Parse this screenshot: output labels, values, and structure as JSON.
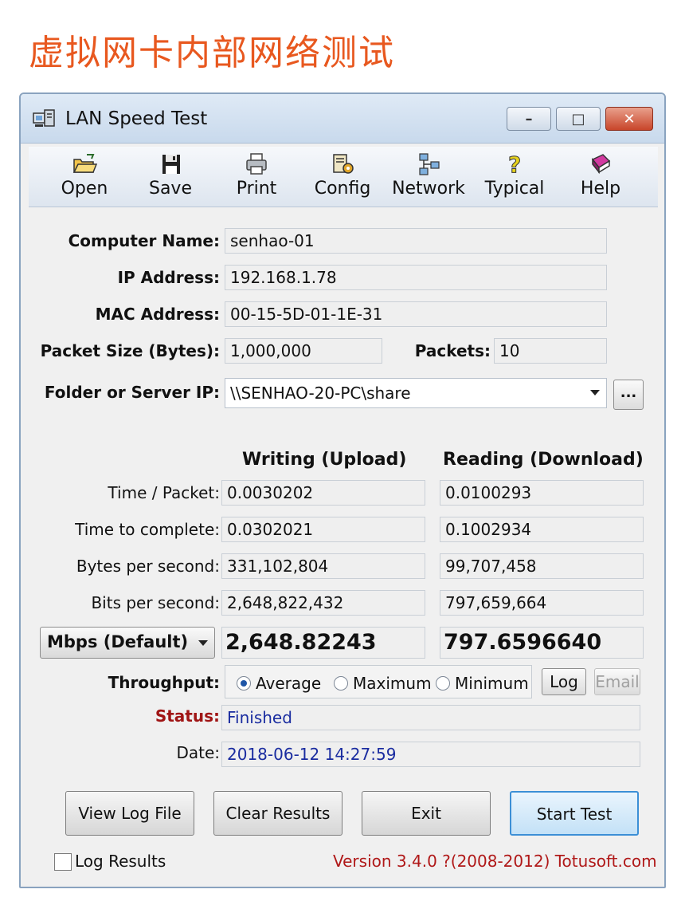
{
  "banner": "虚拟网卡内部网络测试",
  "window": {
    "title": "LAN Speed Test"
  },
  "toolbar": [
    {
      "label": "Open",
      "icon": "folder-open-icon"
    },
    {
      "label": "Save",
      "icon": "floppy-disk-icon"
    },
    {
      "label": "Print",
      "icon": "printer-icon"
    },
    {
      "label": "Config",
      "icon": "config-icon"
    },
    {
      "label": "Network",
      "icon": "network-icon"
    },
    {
      "label": "Typical",
      "icon": "question-icon"
    },
    {
      "label": "Help",
      "icon": "help-book-icon"
    }
  ],
  "info": {
    "computer_name_label": "Computer Name:",
    "computer_name": "senhao-01",
    "ip_label": "IP Address:",
    "ip": "192.168.1.78",
    "mac_label": "MAC Address:",
    "mac": "00-15-5D-01-1E-31",
    "packet_size_label": "Packet Size (Bytes):",
    "packet_size": "1,000,000",
    "packets_label": "Packets:",
    "packets": "10",
    "folder_label": "Folder or Server IP:",
    "folder": "\\\\SENHAO-20-PC\\share",
    "browse_label": "..."
  },
  "results": {
    "writing_header": "Writing (Upload)",
    "reading_header": "Reading (Download)",
    "rows": [
      {
        "label": "Time / Packet:",
        "write": "0.0030202",
        "read": "0.0100293"
      },
      {
        "label": "Time to complete:",
        "write": "0.0302021",
        "read": "0.1002934"
      },
      {
        "label": "Bytes per second:",
        "write": "331,102,804",
        "read": "99,707,458"
      },
      {
        "label": "Bits per second:",
        "write": "2,648,822,432",
        "read": "797,659,664"
      }
    ],
    "unit": "Mbps (Default)",
    "write_big": "2,648.82243",
    "read_big": "797.6596640"
  },
  "throughput": {
    "label": "Throughput:",
    "options": [
      "Average",
      "Maximum",
      "Minimum"
    ],
    "selected": "Average",
    "log_label": "Log",
    "email_label": "Email"
  },
  "status": {
    "label": "Status:",
    "value": "Finished",
    "date_label": "Date:",
    "date": "2018-06-12 14:27:59"
  },
  "buttons": {
    "view_log": "View Log File",
    "clear": "Clear Results",
    "exit": "Exit",
    "start": "Start Test"
  },
  "footer": {
    "log_results": "Log Results",
    "version": "Version 3.4.0  ?(2008-2012) Totusoft.com"
  },
  "colors": {
    "banner": "#e8581f",
    "status_label": "#a01515",
    "value_blue": "#1a2ca0",
    "version": "#b01818"
  }
}
